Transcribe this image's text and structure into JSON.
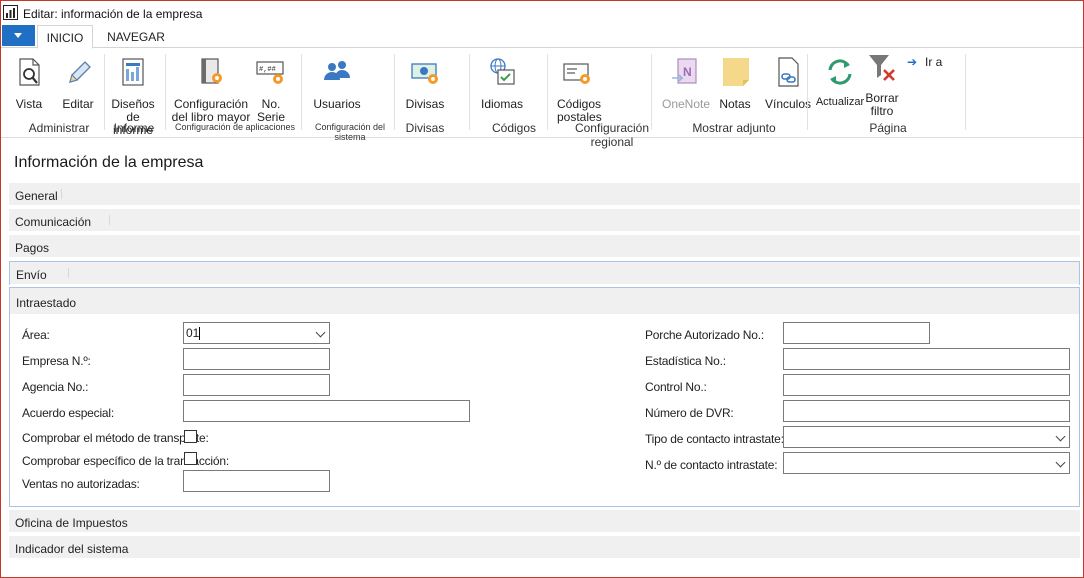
{
  "window": {
    "title": "Editar: información de la empresa"
  },
  "tabs": [
    {
      "label": "INICIO"
    },
    {
      "label": "NAVEGAR"
    }
  ],
  "ribbon": {
    "buttons": {
      "vista": "Vista",
      "editar": "Editar",
      "disenos": "Diseños de informe",
      "config_libro": "Configuración del libro mayor",
      "no_serie": "No. Serie",
      "usuarios": "Usuarios",
      "divisas": "Divisas",
      "idiomas": "Idiomas",
      "codigos_postales": "Códigos postales",
      "onenote": "OneNote",
      "notas": "Notas",
      "vinculos": "Vínculos",
      "actualizar": "Actualizar",
      "borrar_filtro": "Borrar filtro",
      "ir_a": "Ir a"
    },
    "groups": {
      "administrar": "Administrar",
      "informe": "Informe",
      "config_aplicaciones": "Configuración de aplicaciones",
      "config_sistema": "Configuración del sistema",
      "divisas": "Divisas",
      "codigos": "Códigos",
      "config_regional": "Configuración regional",
      "mostrar_adjunto": "Mostrar adjunto",
      "pagina": "Página"
    }
  },
  "page": {
    "title": "Información de la empresa"
  },
  "fasttabs": {
    "general": "General",
    "comunicacion": "Comunicación",
    "pagos": "Pagos",
    "envio": "Envío",
    "intraestado": "Intraestado",
    "oficina": "Oficina de Impuestos",
    "indicador": "Indicador del sistema"
  },
  "intraestado": {
    "left": {
      "area": {
        "label": "Área:",
        "value": "01"
      },
      "empresa": {
        "label": "Empresa N.º:",
        "value": ""
      },
      "agencia": {
        "label": "Agencia No.:",
        "value": ""
      },
      "acuerdo": {
        "label": "Acuerdo especial:",
        "value": ""
      },
      "comprobar_transporte": {
        "label": "Comprobar el método de transporte:"
      },
      "comprobar_transaccion": {
        "label": "Comprobar específico de la transacción:"
      },
      "ventas": {
        "label": "Ventas no autorizadas:",
        "value": ""
      }
    },
    "right": {
      "porche": {
        "label": "Porche Autorizado No.:",
        "value": ""
      },
      "estadistica": {
        "label": "Estadística No.:",
        "value": ""
      },
      "control": {
        "label": "Control No.:",
        "value": ""
      },
      "dvr": {
        "label": "Número de DVR:",
        "value": ""
      },
      "tipo_contacto": {
        "label": "Tipo de contacto intrastate:",
        "value": ""
      },
      "num_contacto": {
        "label": "N.º de contacto intrastate:",
        "value": ""
      }
    }
  },
  "colors": {
    "accent": "#1f6fc5",
    "frame": "#c0392b",
    "fasttab_bg": "#f0f0f0",
    "focus_border": "#a8c4e6"
  }
}
